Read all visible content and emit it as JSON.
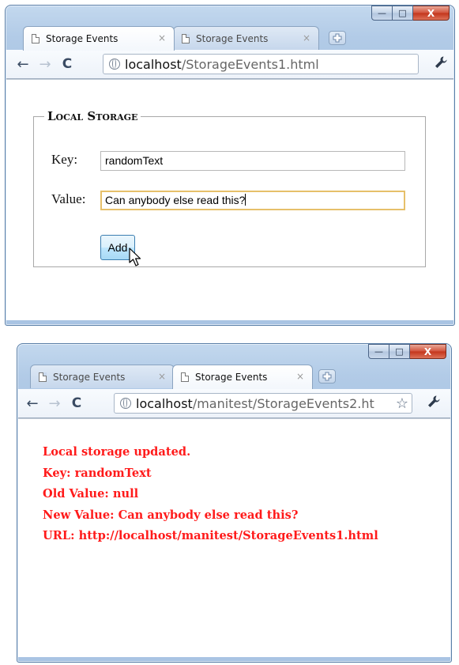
{
  "window1": {
    "tabs": [
      {
        "title": "Storage Events",
        "close": "×",
        "active": true
      },
      {
        "title": "Storage Events",
        "close": "×",
        "active": false
      }
    ],
    "new_tab_icon": "new-tab-icon",
    "address": {
      "host": "localhost",
      "path": "/StorageEvents1.html"
    },
    "form": {
      "legend": "Local Storage",
      "key_label": "Key:",
      "key_value": "randomText",
      "value_label": "Value:",
      "value_value": "Can anybody else read this?",
      "add_label": "Add"
    }
  },
  "window2": {
    "tabs": [
      {
        "title": "Storage Events",
        "close": "×",
        "active": false
      },
      {
        "title": "Storage Events",
        "close": "×",
        "active": true
      }
    ],
    "address": {
      "host": "localhost",
      "path": "/manitest/StorageEvents2.ht"
    },
    "log": [
      "Local storage updated.",
      "Key: randomText",
      "Old Value: null",
      "New Value: Can anybody else read this?",
      "URL: http://localhost/manitest/StorageEvents1.html"
    ]
  },
  "caption_buttons": {
    "minimize": "—",
    "maximize": "□",
    "close": "X"
  },
  "icons": {
    "back": "back-arrow-icon",
    "forward": "forward-arrow-icon",
    "reload": "reload-icon",
    "globe": "globe-icon",
    "wrench": "wrench-icon",
    "star": "bookmark-star-icon"
  },
  "colors": {
    "log_text": "#ff1a1a",
    "frame": "#b2cbe7",
    "focus_ring": "#e6c06a"
  }
}
